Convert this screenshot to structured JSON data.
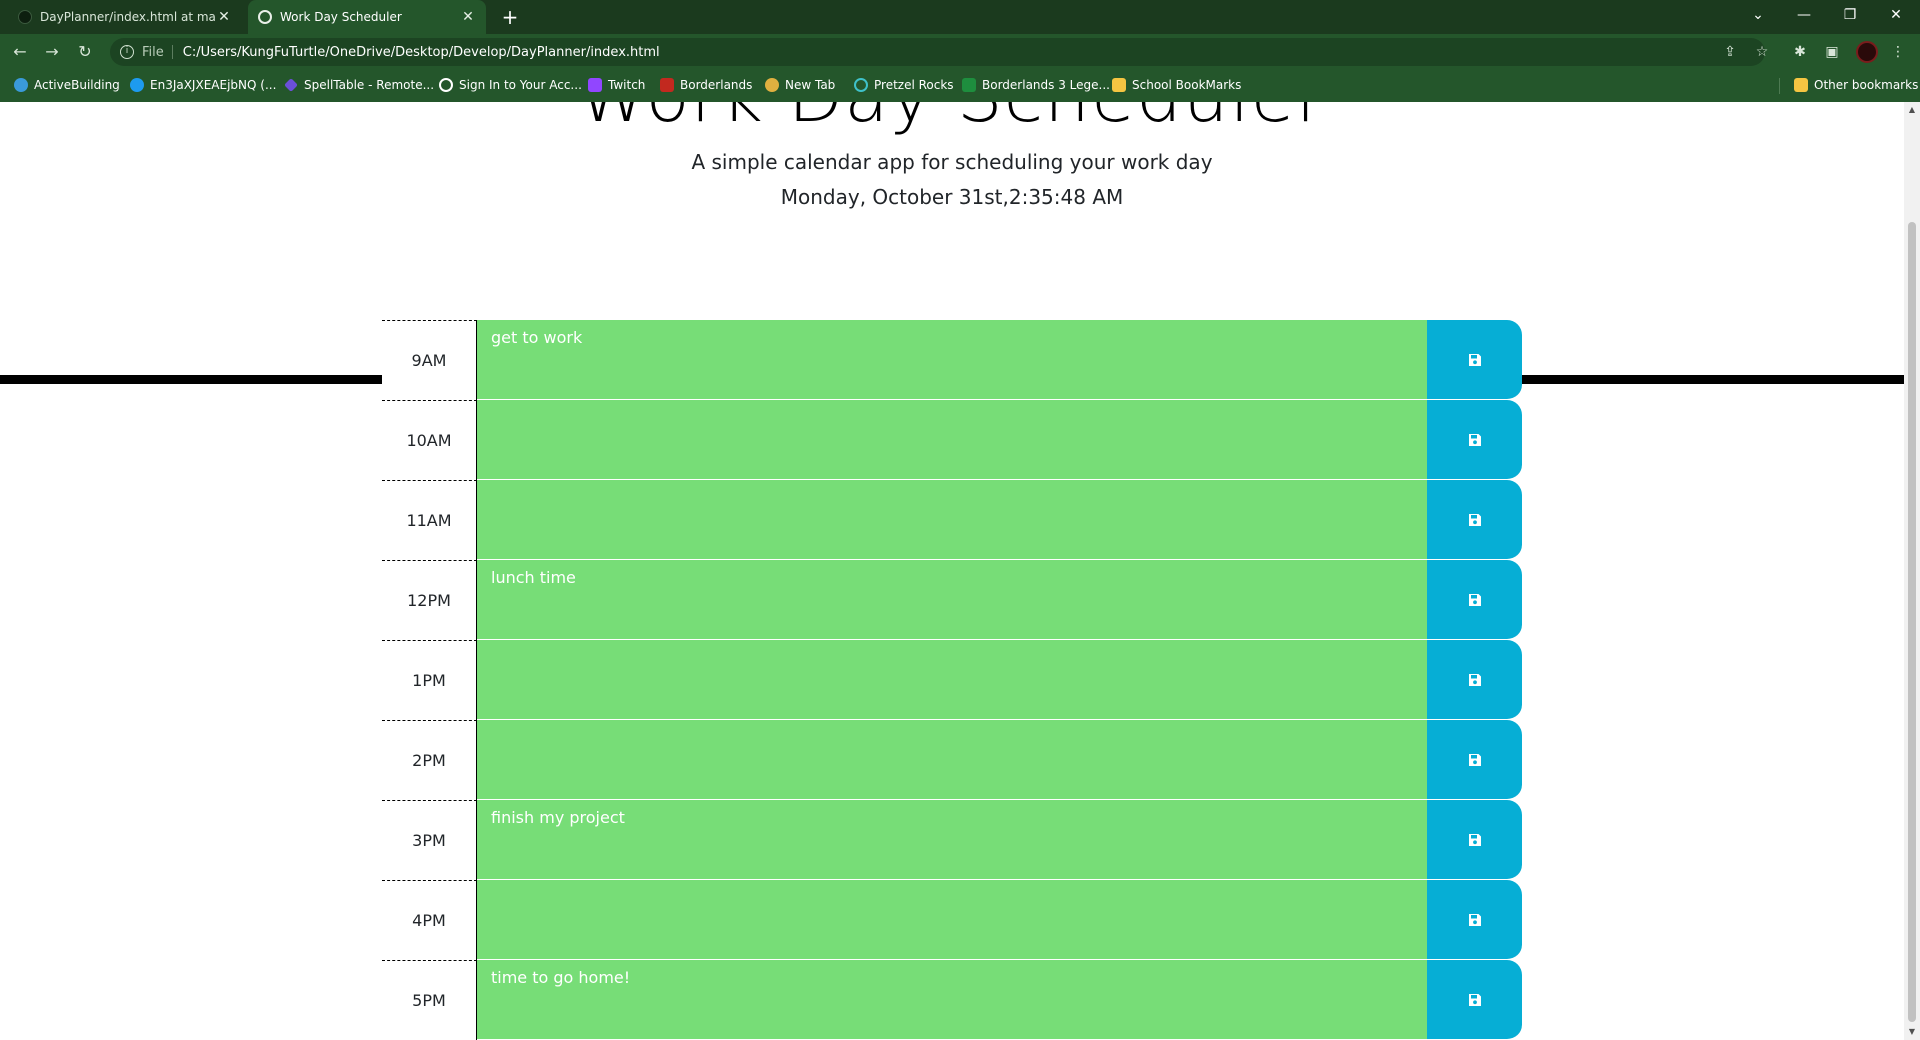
{
  "browser": {
    "tabs": [
      {
        "title": "DayPlanner/index.html at main · ",
        "active": false,
        "icon": "github-icon"
      },
      {
        "title": "Work Day Scheduler",
        "active": true,
        "icon": "globe-icon"
      }
    ],
    "new_tab_label": "+",
    "window_controls": {
      "dropdown": "⌄",
      "minimize": "—",
      "restore": "❐",
      "close": "✕"
    },
    "nav": {
      "back": "←",
      "forward": "→",
      "reload": "↻"
    },
    "omnibox": {
      "info": "i",
      "scheme_label": "File",
      "url": "C:/Users/KungFuTurtle/OneDrive/Desktop/Develop/DayPlanner/index.html"
    },
    "toolbar_icons": {
      "share": "⇪",
      "bookmark_star": "☆",
      "extensions": "✱",
      "side_panel": "▣",
      "menu": "⋮"
    },
    "bookmarks": [
      {
        "label": "ActiveBuilding",
        "color": "#3a9ad9"
      },
      {
        "label": "En3JaXJXEAEjbNQ (...",
        "color": "#1d9bf0"
      },
      {
        "label": "SpellTable - Remote...",
        "color": "#6b4fd8"
      },
      {
        "label": "Sign In to Your Acc...",
        "color": "#ffffff"
      },
      {
        "label": "Twitch",
        "color": "#9146ff"
      },
      {
        "label": "Borderlands",
        "color": "#c2291f"
      },
      {
        "label": "New Tab",
        "color": "#e0b040"
      },
      {
        "label": "Pretzel Rocks",
        "color": "#3fc1c9"
      },
      {
        "label": "Borderlands 3 Lege...",
        "color": "#1e8e3e"
      },
      {
        "label": "School BookMarks",
        "color": "#f5c542"
      }
    ],
    "other_bookmarks": "Other bookmarks"
  },
  "header": {
    "title": "Work Day Scheduler",
    "lead": "A simple calendar app for scheduling your work day",
    "current_day": "Monday, October 31st,2:35:48 AM"
  },
  "colors": {
    "present_or_future_block": "#77dd77",
    "save_button": "#06aed5",
    "divider": "#000000"
  },
  "schedule": [
    {
      "hour": "9AM",
      "text": "get to work"
    },
    {
      "hour": "10AM",
      "text": ""
    },
    {
      "hour": "11AM",
      "text": ""
    },
    {
      "hour": "12PM",
      "text": "lunch time"
    },
    {
      "hour": "1PM",
      "text": ""
    },
    {
      "hour": "2PM",
      "text": ""
    },
    {
      "hour": "3PM",
      "text": "finish my project"
    },
    {
      "hour": "4PM",
      "text": ""
    },
    {
      "hour": "5PM",
      "text": "time to go home!"
    }
  ]
}
